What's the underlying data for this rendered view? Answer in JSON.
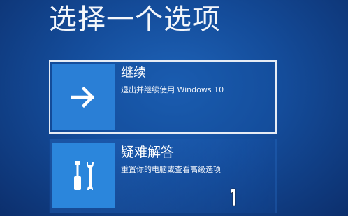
{
  "page": {
    "title": "选择一个选项"
  },
  "options": [
    {
      "title": "继续",
      "description": "退出并继续使用 Windows 10",
      "icon": "arrow-right-icon"
    },
    {
      "title": "疑难解答",
      "description": "重置你的电脑或查看高级选项",
      "icon": "tools-icon"
    }
  ],
  "colors": {
    "background": "#144c9a",
    "tile": "#2a7fd6",
    "text": "#ffffff",
    "focus_border": "#e6ecf5"
  }
}
